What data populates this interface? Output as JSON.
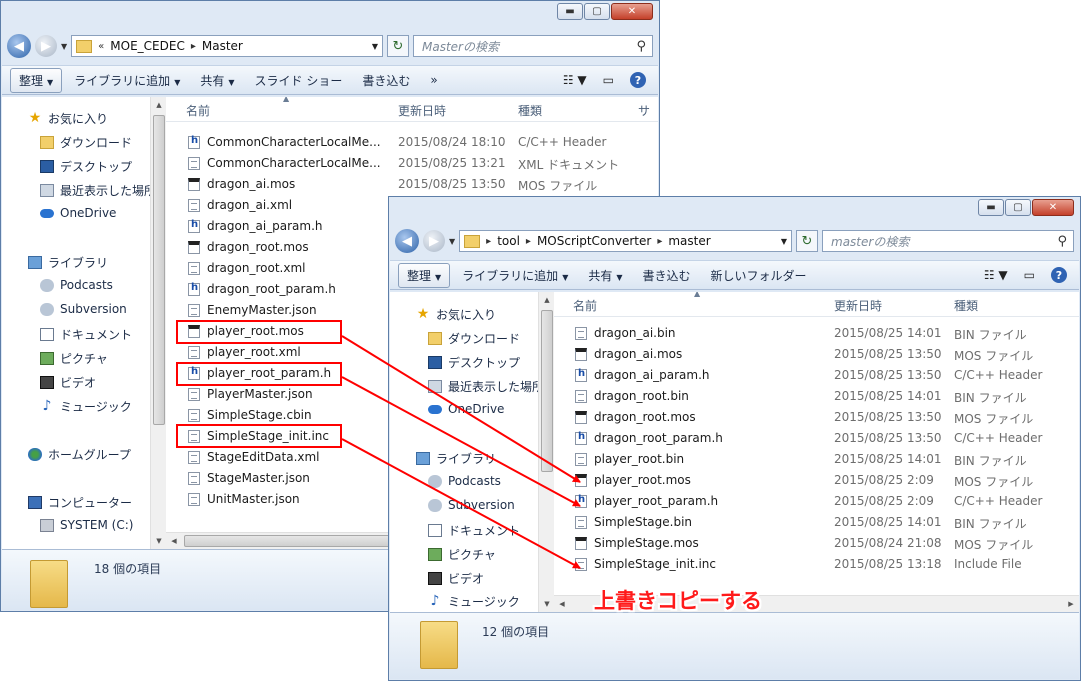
{
  "window_controls": {
    "minimize": "▬",
    "maximize": "▢",
    "close": "✕"
  },
  "left_window": {
    "address_segments": [
      "«",
      "MOE_CEDEC",
      "▸",
      "Master"
    ],
    "search_placeholder": "Masterの検索",
    "toolbar": {
      "organize": "整理",
      "add_library": "ライブラリに追加",
      "share": "共有",
      "slideshow": "スライド ショー",
      "burn": "書き込む",
      "more": "»"
    },
    "nav_items": [
      "お気に入り",
      "ダウンロード",
      "デスクトップ",
      "最近表示した場所",
      "OneDrive",
      "ライブラリ",
      "Podcasts",
      "Subversion",
      "ドキュメント",
      "ピクチャ",
      "ビデオ",
      "ミュージック",
      "ホームグループ",
      "コンピューター",
      "SYSTEM (C:)"
    ],
    "columns": {
      "name": "名前",
      "date": "更新日時",
      "type": "種類",
      "size": "サ"
    },
    "files": [
      {
        "name": "CommonCharacterLocalMe...",
        "date": "2015/08/24 18:10",
        "type": "C/C++ Header",
        "icon": "h"
      },
      {
        "name": "CommonCharacterLocalMe...",
        "date": "2015/08/25 13:21",
        "type": "XML ドキュメント",
        "icon": "txt"
      },
      {
        "name": "dragon_ai.mos",
        "date": "2015/08/25 13:50",
        "type": "MOS ファイル",
        "icon": "mos"
      },
      {
        "name": "dragon_ai.xml",
        "date": "",
        "type": "",
        "icon": "txt"
      },
      {
        "name": "dragon_ai_param.h",
        "date": "",
        "type": "",
        "icon": "h"
      },
      {
        "name": "dragon_root.mos",
        "date": "",
        "type": "",
        "icon": "mos"
      },
      {
        "name": "dragon_root.xml",
        "date": "",
        "type": "",
        "icon": "txt"
      },
      {
        "name": "dragon_root_param.h",
        "date": "",
        "type": "",
        "icon": "h"
      },
      {
        "name": "EnemyMaster.json",
        "date": "",
        "type": "",
        "icon": "txt"
      },
      {
        "name": "player_root.mos",
        "date": "",
        "type": "",
        "icon": "mos"
      },
      {
        "name": "player_root.xml",
        "date": "",
        "type": "",
        "icon": "txt"
      },
      {
        "name": "player_root_param.h",
        "date": "",
        "type": "",
        "icon": "h"
      },
      {
        "name": "PlayerMaster.json",
        "date": "",
        "type": "",
        "icon": "txt"
      },
      {
        "name": "SimpleStage.cbin",
        "date": "",
        "type": "",
        "icon": "txt"
      },
      {
        "name": "SimpleStage_init.inc",
        "date": "",
        "type": "",
        "icon": "txt"
      },
      {
        "name": "StageEditData.xml",
        "date": "",
        "type": "",
        "icon": "txt"
      },
      {
        "name": "StageMaster.json",
        "date": "",
        "type": "",
        "icon": "txt"
      },
      {
        "name": "UnitMaster.json",
        "date": "",
        "type": "",
        "icon": "txt"
      }
    ],
    "status": "18 個の項目"
  },
  "right_window": {
    "address_segments": [
      "▸",
      "tool",
      "▸",
      "MOScriptConverter",
      "▸",
      "master"
    ],
    "search_placeholder": "masterの検索",
    "toolbar": {
      "organize": "整理",
      "add_library": "ライブラリに追加",
      "share": "共有",
      "burn": "書き込む",
      "new_folder": "新しいフォルダー"
    },
    "nav_items": [
      "お気に入り",
      "ダウンロード",
      "デスクトップ",
      "最近表示した場所",
      "OneDrive",
      "ライブラリ",
      "Podcasts",
      "Subversion",
      "ドキュメント",
      "ピクチャ",
      "ビデオ",
      "ミュージック"
    ],
    "columns": {
      "name": "名前",
      "date": "更新日時",
      "type": "種類"
    },
    "files": [
      {
        "name": "dragon_ai.bin",
        "date": "2015/08/25 14:01",
        "type": "BIN ファイル",
        "icon": "txt"
      },
      {
        "name": "dragon_ai.mos",
        "date": "2015/08/25 13:50",
        "type": "MOS ファイル",
        "icon": "mos"
      },
      {
        "name": "dragon_ai_param.h",
        "date": "2015/08/25 13:50",
        "type": "C/C++ Header",
        "icon": "h"
      },
      {
        "name": "dragon_root.bin",
        "date": "2015/08/25 14:01",
        "type": "BIN ファイル",
        "icon": "txt"
      },
      {
        "name": "dragon_root.mos",
        "date": "2015/08/25 13:50",
        "type": "MOS ファイル",
        "icon": "mos"
      },
      {
        "name": "dragon_root_param.h",
        "date": "2015/08/25 13:50",
        "type": "C/C++ Header",
        "icon": "h"
      },
      {
        "name": "player_root.bin",
        "date": "2015/08/25 14:01",
        "type": "BIN ファイル",
        "icon": "txt"
      },
      {
        "name": "player_root.mos",
        "date": "2015/08/25 2:09",
        "type": "MOS ファイル",
        "icon": "mos"
      },
      {
        "name": "player_root_param.h",
        "date": "2015/08/25 2:09",
        "type": "C/C++ Header",
        "icon": "h"
      },
      {
        "name": "SimpleStage.bin",
        "date": "2015/08/25 14:01",
        "type": "BIN ファイル",
        "icon": "txt"
      },
      {
        "name": "SimpleStage.mos",
        "date": "2015/08/24 21:08",
        "type": "MOS ファイル",
        "icon": "mos"
      },
      {
        "name": "SimpleStage_init.inc",
        "date": "2015/08/25 13:18",
        "type": "Include File",
        "icon": "txt"
      }
    ],
    "status": "12 個の項目"
  },
  "annotation": {
    "overwrite_label": "上書きコピーする",
    "color": "#ff0000"
  }
}
